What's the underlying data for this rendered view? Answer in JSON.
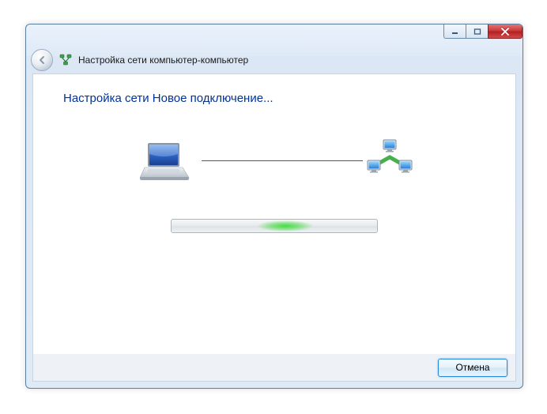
{
  "window": {
    "title": "Настройка сети компьютер-компьютер"
  },
  "content": {
    "heading": "Настройка сети Новое подключение..."
  },
  "buttons": {
    "cancel": "Отмена"
  },
  "icons": {
    "back": "back-arrow",
    "wizard": "network-adhoc",
    "laptop": "laptop",
    "network": "network-group",
    "minimize": "minimize",
    "maximize": "maximize",
    "close": "close"
  }
}
